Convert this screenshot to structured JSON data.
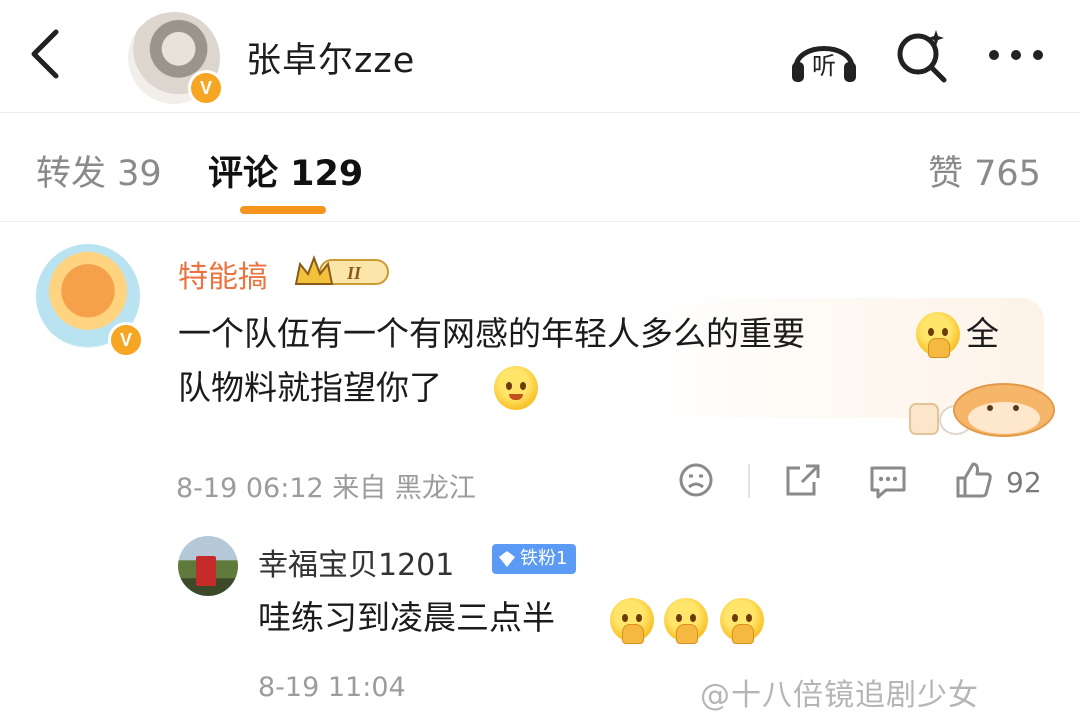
{
  "header": {
    "title": "张卓尔zze",
    "verified_badge": "V",
    "listen_label": "听",
    "icons": [
      "back-arrow-icon",
      "headphones-icon",
      "search-icon",
      "more-icon"
    ]
  },
  "tabs": [
    {
      "label": "转发 39",
      "active": false
    },
    {
      "label": "评论 129",
      "active": true
    },
    {
      "label": "赞 765",
      "active": false
    }
  ],
  "comments": [
    {
      "user": "特能搞",
      "level_badge": "II",
      "verified_badge": "V",
      "text_line1": "一个队伍有一个有网感的年轻人多么的重要",
      "text_line1_tail": "全",
      "text_line2": "队物料就指望你了",
      "meta": "8-19 06:12  来自 黑龙江",
      "likes": "92"
    }
  ],
  "reply": {
    "user": "幸福宝贝1201",
    "badge": "铁粉1",
    "text": "哇练习到凌晨三点半",
    "meta": "8-19 11:04"
  },
  "watermark": "@十八倍镜追剧少女",
  "colors": {
    "accent": "#f7941d",
    "username": "#eb7340",
    "verified": "#f6a623",
    "fan_badge": "#5b9bf5"
  }
}
